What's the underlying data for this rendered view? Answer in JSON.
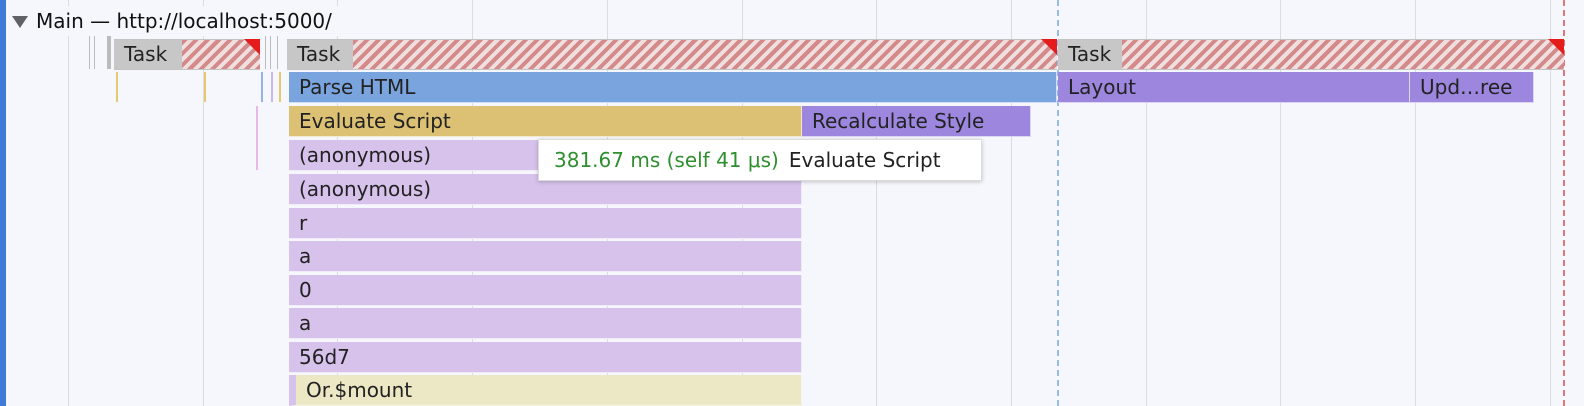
{
  "track": {
    "title": "Main — http://localhost:5000/"
  },
  "tasks": [
    {
      "label": "Task"
    },
    {
      "label": "Task"
    },
    {
      "label": "Task"
    }
  ],
  "events": {
    "parse_html": "Parse HTML",
    "layout": "Layout",
    "update_layer_tree": "Upd…ree",
    "evaluate_script": "Evaluate Script",
    "recalculate_style": "Recalculate Style",
    "stack": [
      "(anonymous)",
      "(anonymous)",
      "r",
      "a",
      "0",
      "a",
      "56d7",
      "Or.$mount"
    ]
  },
  "tooltip": {
    "time": "381.67 ms (self 41 μs)",
    "name": "Evaluate Script"
  },
  "colors": {
    "task_gray": "#c7c7c7",
    "parse_html": "#7aa4de",
    "evaluate_script": "#dcc073",
    "recalculate_style": "#9c86de",
    "stack_frame": "#d7c2eb",
    "mount_frame": "#ece7c4",
    "long_task_warning": "#e51c1c"
  },
  "icons": {
    "expand": "chevron-down-icon"
  }
}
